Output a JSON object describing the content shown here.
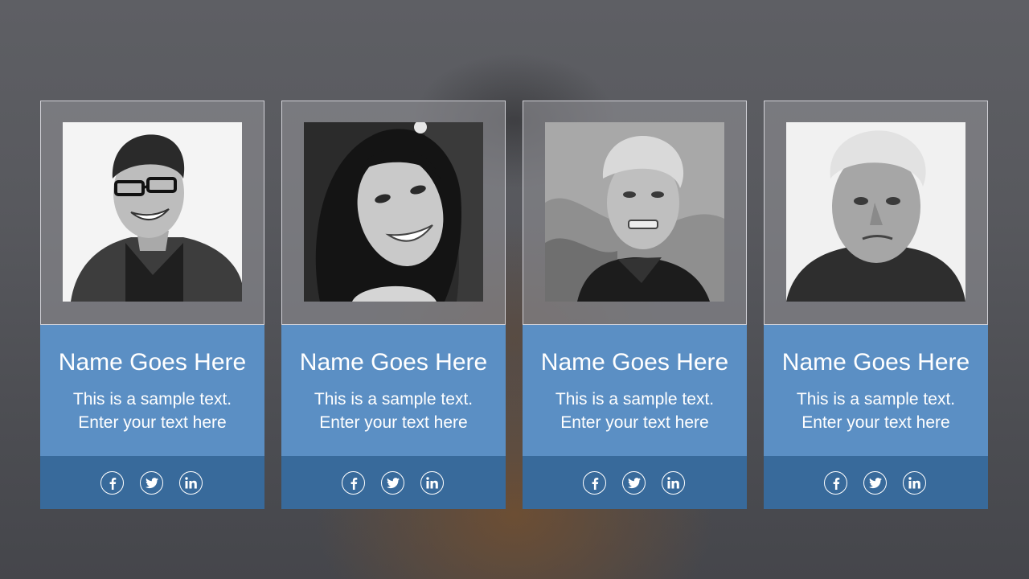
{
  "members": [
    {
      "name": "Name Goes Here",
      "description_line1": "This is a sample text.",
      "description_line2": "Enter your text here",
      "photo": "portrait-young-man-glasses",
      "social": [
        "facebook-icon",
        "twitter-icon",
        "linkedin-icon"
      ]
    },
    {
      "name": "Name Goes Here",
      "description_line1": "This is a sample text.",
      "description_line2": "Enter your text here",
      "photo": "portrait-smiling-woman",
      "social": [
        "facebook-icon",
        "twitter-icon",
        "linkedin-icon"
      ]
    },
    {
      "name": "Name Goes Here",
      "description_line1": "This is a sample text.",
      "description_line2": "Enter your text here",
      "photo": "portrait-grimacing-man",
      "social": [
        "facebook-icon",
        "twitter-icon",
        "linkedin-icon"
      ]
    },
    {
      "name": "Name Goes Here",
      "description_line1": "This is a sample text.",
      "description_line2": "Enter your text here",
      "photo": "portrait-elderly-man",
      "social": [
        "facebook-icon",
        "twitter-icon",
        "linkedin-icon"
      ]
    }
  ],
  "colors": {
    "info_panel": "#5b8fc4",
    "social_bar": "#386a9b",
    "text": "#ffffff",
    "photo_frame": "#8c8d92"
  }
}
